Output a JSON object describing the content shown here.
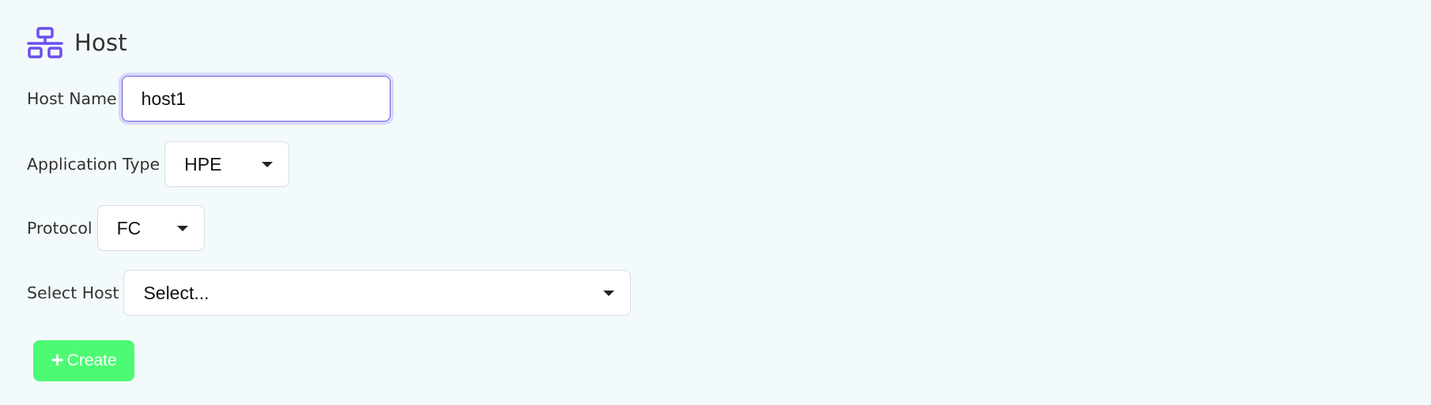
{
  "header": {
    "title": "Host",
    "icon": "network-icon",
    "icon_color": "#6b4ef0"
  },
  "form": {
    "host_name": {
      "label": "Host Name",
      "value": "host1"
    },
    "application_type": {
      "label": "Application Type",
      "selected": "HPE"
    },
    "protocol": {
      "label": "Protocol",
      "selected": "FC"
    },
    "select_host": {
      "label": "Select Host",
      "placeholder": "Select..."
    }
  },
  "actions": {
    "create_label": "Create",
    "create_icon": "plus-icon",
    "create_color": "#4cfb73"
  }
}
